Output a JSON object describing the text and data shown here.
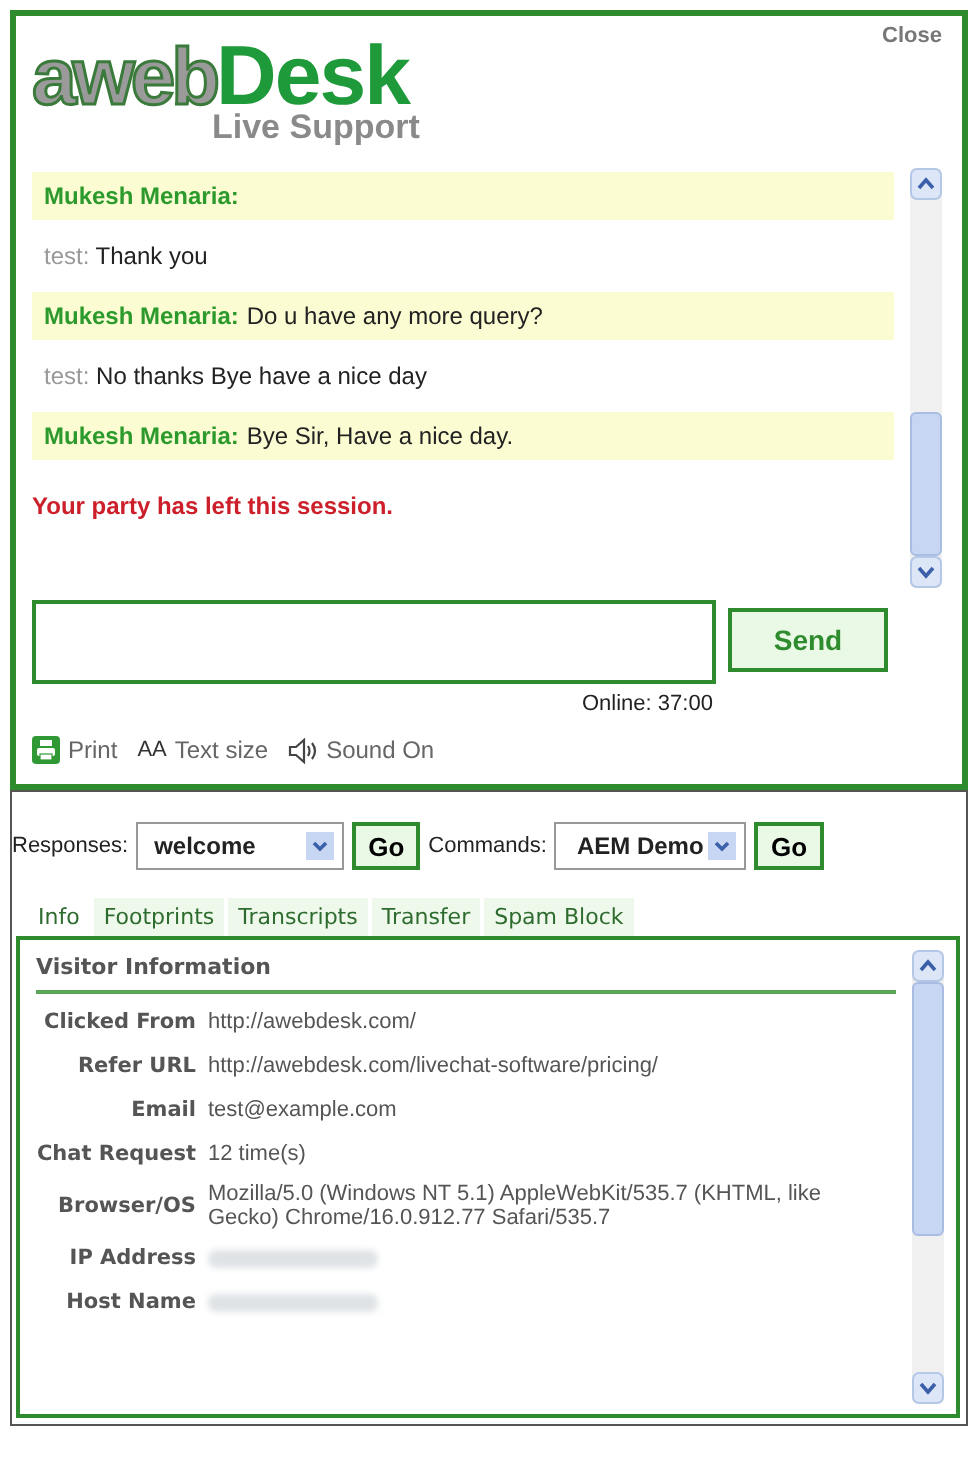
{
  "header": {
    "logo": {
      "part_1": "aweb",
      "part_2": "Desk",
      "tagline": "Live Support"
    },
    "close": "Close"
  },
  "messages": [
    {
      "kind": "agent",
      "sender": "Mukesh Menaria:"
    },
    {
      "kind": "visitor",
      "sender": "test:",
      "text": "Thank you"
    },
    {
      "kind": "agent",
      "sender": "Mukesh Menaria:",
      "text": "Do u have any more query?"
    },
    {
      "kind": "visitor",
      "sender": "test:",
      "text": "No thanks Bye have a nice day"
    },
    {
      "kind": "agent",
      "sender": "Mukesh Menaria:",
      "text": "Bye Sir, Have a nice day."
    },
    {
      "kind": "system",
      "text": "Your party has left this session."
    }
  ],
  "send_button": "Send",
  "online": "Online: 37:00",
  "toolbar": [
    {
      "kind": "print",
      "label": "Print"
    },
    {
      "kind": "textsize",
      "icon": "AA",
      "label": "Text size"
    },
    {
      "kind": "sound",
      "label": "Sound On"
    }
  ],
  "responses": {
    "label": "Responses:",
    "value": "welcome",
    "button": "Go"
  },
  "commands": {
    "label": "Commands:",
    "value": "AEM Demo",
    "button": "Go"
  },
  "tabs": [
    {
      "label": "Info",
      "selected": true
    },
    {
      "label": "Footprints",
      "selected": false
    },
    {
      "label": "Transcripts",
      "selected": false
    },
    {
      "label": "Transfer",
      "selected": false
    },
    {
      "label": "Spam Block",
      "selected": false
    }
  ],
  "visitor_info": {
    "title": "Visitor Information",
    "rows": [
      {
        "label": "Clicked From",
        "value": "http://awebdesk.com/"
      },
      {
        "label": "Refer URL",
        "value": "http://awebdesk.com/livechat-software/pricing/"
      },
      {
        "label": "Email",
        "value": "test@example.com"
      },
      {
        "label": "Chat Request",
        "value": "12 time(s)"
      },
      {
        "label": "Browser/OS",
        "value": "Mozilla/5.0 (Windows NT 5.1) AppleWebKit/535.7 (KHTML, like Gecko) Chrome/16.0.912.77 Safari/535.7"
      },
      {
        "label": "IP Address",
        "blurred": true
      },
      {
        "label": "Host Name",
        "blurred": true
      }
    ]
  }
}
